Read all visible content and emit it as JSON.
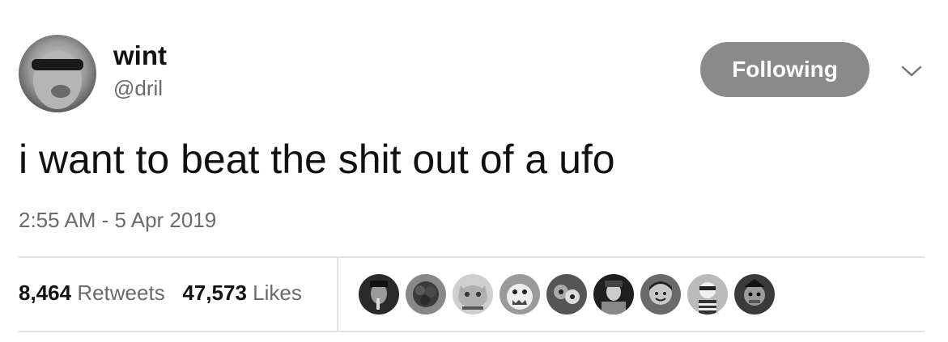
{
  "author": {
    "name": "wint",
    "handle": "@dril"
  },
  "follow_button": {
    "label": "Following"
  },
  "tweet": {
    "text": "i want to beat the shit out of a ufo",
    "timestamp": "2:55 AM - 5 Apr 2019"
  },
  "stats": {
    "retweets_count": "8,464",
    "retweets_label": "Retweets",
    "likes_count": "47,573",
    "likes_label": "Likes"
  },
  "icons": {
    "more_menu": "chevron-down-icon"
  },
  "colors": {
    "follow_button_bg": "#8a8a8a",
    "secondary_text": "#6b6b6b",
    "divider": "#e3e3e3"
  },
  "likers_count_shown": 9
}
